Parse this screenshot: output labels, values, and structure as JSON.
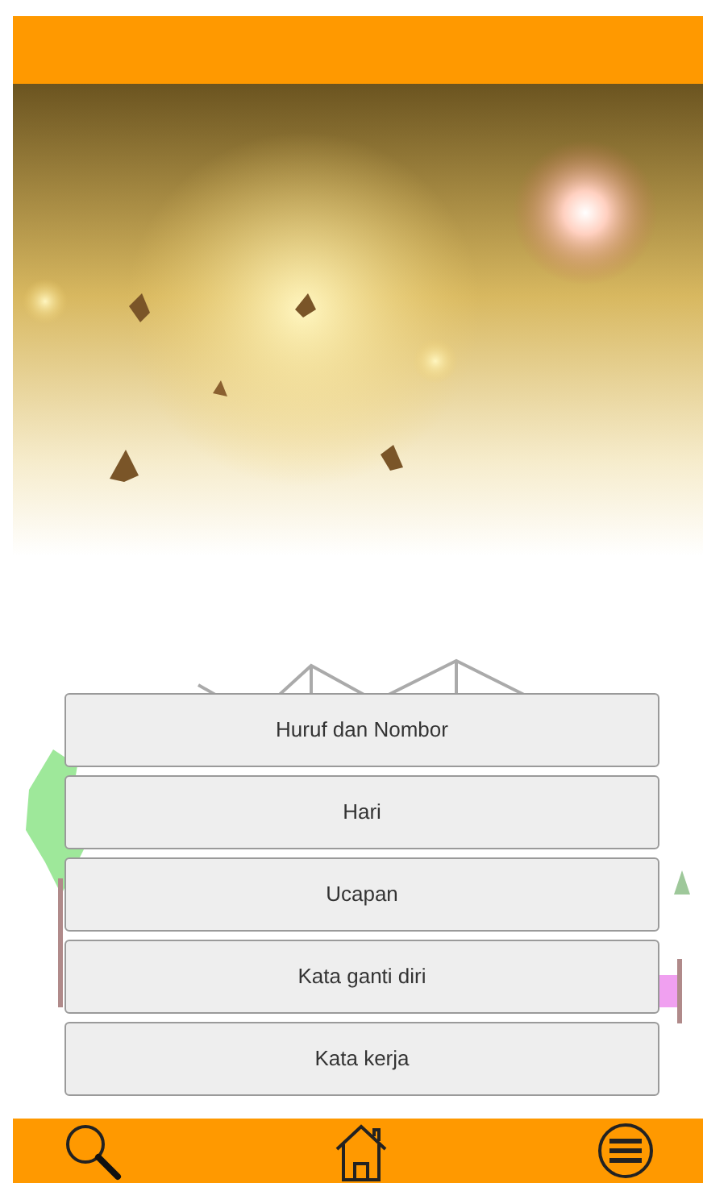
{
  "menu": [
    {
      "label": "Huruf dan Nombor"
    },
    {
      "label": "Hari"
    },
    {
      "label": "Ucapan"
    },
    {
      "label": "Kata ganti diri"
    },
    {
      "label": "Kata kerja"
    }
  ]
}
